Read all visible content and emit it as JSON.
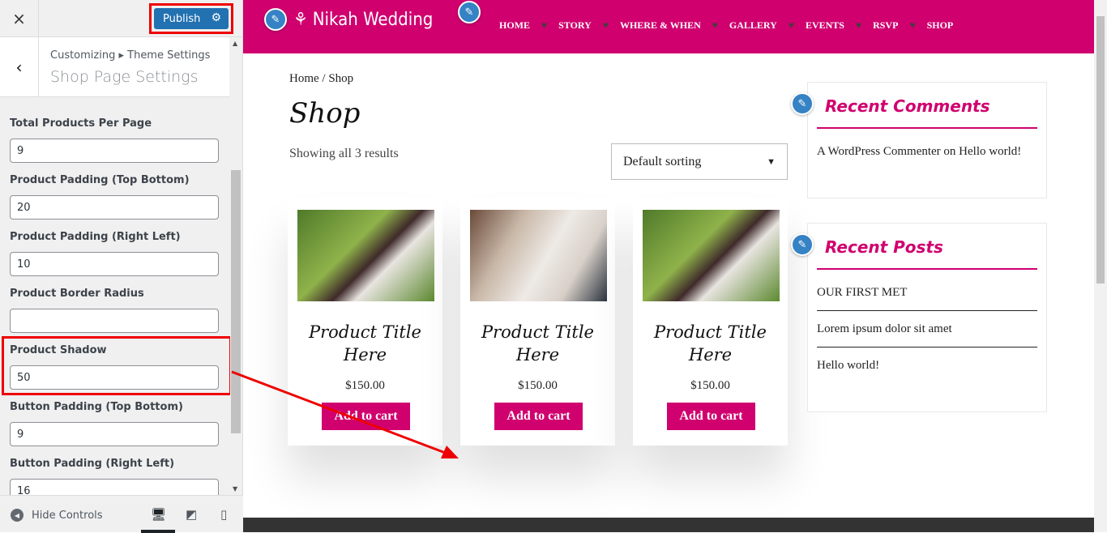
{
  "customizer": {
    "close_icon": "×",
    "publish_label": "Publish",
    "breadcrumb": "Customizing ▸ Theme Settings",
    "section_title": "Shop Page Settings",
    "fields": [
      {
        "label": "Total Products Per Page",
        "value": "9"
      },
      {
        "label": "Product Padding (Top Bottom)",
        "value": "20"
      },
      {
        "label": "Product Padding (Right Left)",
        "value": "10"
      },
      {
        "label": "Product Border Radius",
        "value": ""
      },
      {
        "label": "Product Shadow",
        "value": "50"
      },
      {
        "label": "Button Padding (Top Bottom)",
        "value": "9"
      },
      {
        "label": "Button Padding (Right Left)",
        "value": "16"
      }
    ],
    "hide_controls": "Hide Controls",
    "active_device": "desktop"
  },
  "site": {
    "logo": "Nikah Wedding",
    "menu": [
      "HOME",
      "STORY",
      "WHERE & WHEN",
      "GALLERY",
      "EVENTS",
      "RSVP",
      "SHOP"
    ],
    "brand_color": "#d0006f"
  },
  "shop": {
    "breadcrumb": "Home / Shop",
    "title": "Shop",
    "results": "Showing all 3 results",
    "sorting": "Default sorting",
    "products": [
      {
        "title": "Product Title Here",
        "price": "$150.00",
        "button": "Add to cart"
      },
      {
        "title": "Product Title Here",
        "price": "$150.00",
        "button": "Add to cart"
      },
      {
        "title": "Product Title Here",
        "price": "$150.00",
        "button": "Add to cart"
      }
    ]
  },
  "sidebar": {
    "recent_comments_title": "Recent Comments",
    "comment": "A WordPress Commenter on Hello world!",
    "recent_posts_title": "Recent Posts",
    "posts": [
      "OUR FIRST MET",
      "Lorem ipsum dolor sit amet",
      "Hello world!"
    ]
  }
}
